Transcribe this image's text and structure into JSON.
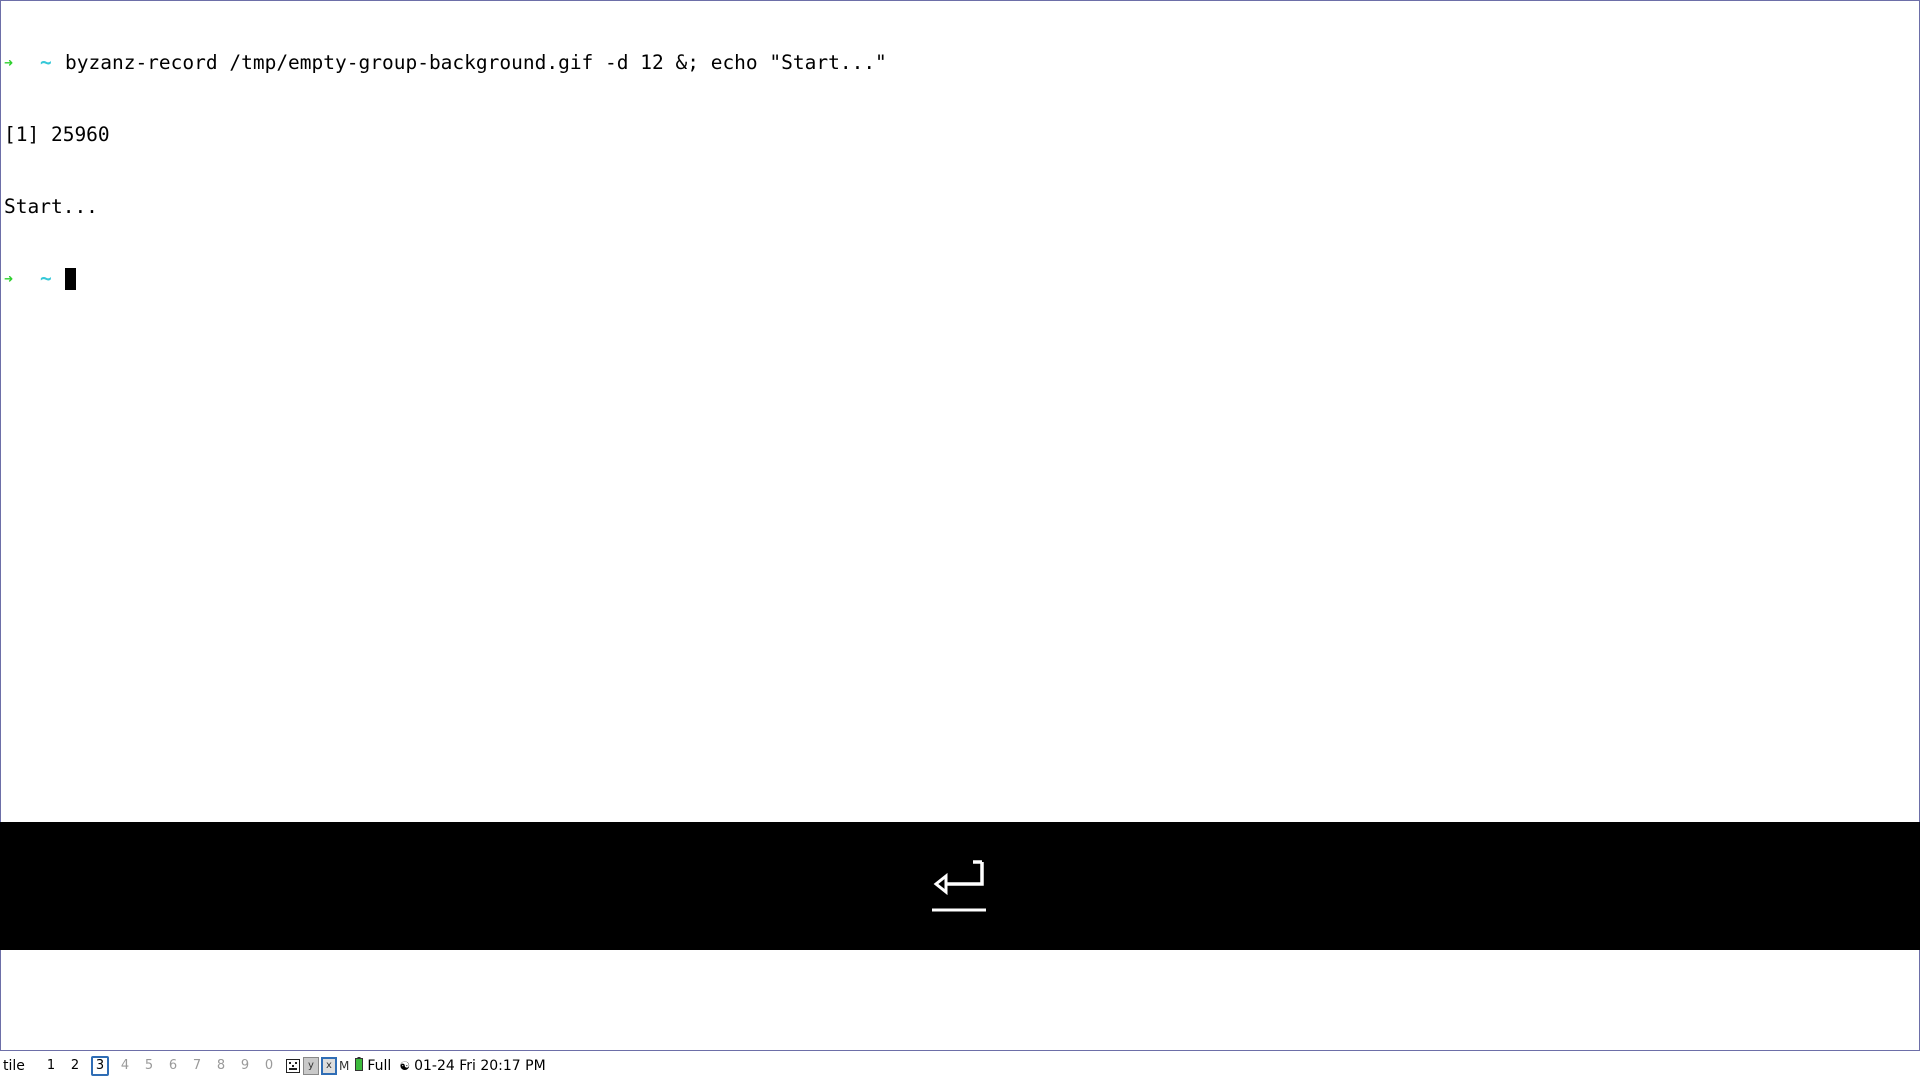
{
  "terminal": {
    "lines": [
      {
        "type": "prompt",
        "arrow": "➜",
        "tilde": "~",
        "text": "byzanz-record /tmp/empty-group-background.gif -d 12 &; echo \"Start...\""
      },
      {
        "type": "output",
        "text": "[1] 25960"
      },
      {
        "type": "output",
        "text": "Start..."
      },
      {
        "type": "prompt",
        "arrow": "➜",
        "tilde": "~",
        "text": ""
      }
    ]
  },
  "key_overlay": {
    "key": "enter-icon"
  },
  "statusbar": {
    "layout": "tile",
    "workspaces": [
      {
        "label": "1",
        "state": "occupied"
      },
      {
        "label": "2",
        "state": "occupied"
      },
      {
        "label": "3",
        "state": "current"
      },
      {
        "label": "4",
        "state": "empty"
      },
      {
        "label": "5",
        "state": "empty"
      },
      {
        "label": "6",
        "state": "empty"
      },
      {
        "label": "7",
        "state": "empty"
      },
      {
        "label": "8",
        "state": "empty"
      },
      {
        "label": "9",
        "state": "empty"
      },
      {
        "label": "0",
        "state": "empty"
      }
    ],
    "tray": {
      "box1": "y",
      "box2": "x",
      "m_label": "M"
    },
    "battery": "Full",
    "clock": "01-24 Fri 20:17 PM"
  },
  "colors": {
    "prompt_arrow": "#2fd02f",
    "prompt_tilde": "#35c8d8",
    "window_border": "#6d6fa8",
    "current_ws_border": "#2f6db5"
  }
}
